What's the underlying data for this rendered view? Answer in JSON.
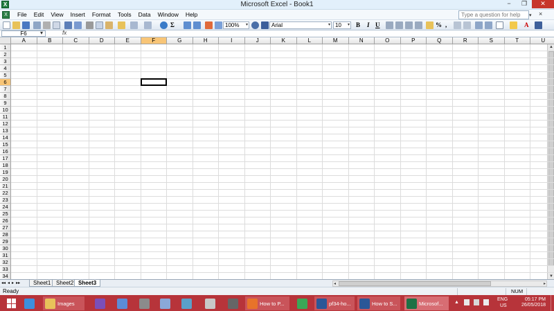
{
  "window": {
    "title": "Microsoft Excel - Book1",
    "app_icon": "X",
    "min": "−",
    "restore": "❐",
    "close": "✕"
  },
  "menu": {
    "items": [
      "File",
      "Edit",
      "View",
      "Insert",
      "Format",
      "Tools",
      "Data",
      "Window",
      "Help"
    ],
    "help_placeholder": "Type a question for help",
    "help_dropdown": "▾",
    "doc_close": "×"
  },
  "toolbar": {
    "zoom": "100%",
    "font": "Arial",
    "font_size": "10",
    "bold": "B",
    "italic": "I",
    "underline": "U",
    "autosum": "Σ",
    "percent": "%",
    "comma": ",",
    "accent_color": "#f2c94c",
    "dropdown": "▾"
  },
  "formula_bar": {
    "name_box": "F6",
    "fx": "fx",
    "name_dd": "▾",
    "content": ""
  },
  "grid": {
    "columns": [
      "A",
      "B",
      "C",
      "D",
      "E",
      "F",
      "G",
      "H",
      "I",
      "J",
      "K",
      "L",
      "M",
      "N",
      "O",
      "P",
      "Q",
      "R",
      "S",
      "T",
      "U"
    ],
    "rows": [
      "1",
      "2",
      "3",
      "4",
      "5",
      "6",
      "7",
      "8",
      "9",
      "10",
      "11",
      "12",
      "13",
      "14",
      "15",
      "16",
      "17",
      "18",
      "19",
      "20",
      "21",
      "22",
      "23",
      "24",
      "25",
      "26",
      "27",
      "28",
      "29",
      "30",
      "31",
      "32",
      "33",
      "34"
    ],
    "active_cell": "F6",
    "active_col": "F",
    "active_row": "6",
    "scroll_up": "▲",
    "scroll_down": "▼"
  },
  "sheets": {
    "nav": [
      "◂◂",
      "◂",
      "▸",
      "▸▸"
    ],
    "tabs": [
      "Sheet1",
      "Sheet2",
      "Sheet3"
    ],
    "active": "Sheet3",
    "scroll_left": "◂",
    "scroll_right": "▸"
  },
  "status": {
    "ready": "Ready",
    "num": "NUM"
  },
  "taskbar": {
    "apps": [
      {
        "name": "internet-explorer",
        "label": "",
        "color": "#3c8fdc"
      },
      {
        "name": "file-explorer",
        "label": "Images",
        "color": "#e8c25a"
      },
      {
        "name": "visual-studio",
        "label": "",
        "color": "#7b4fb8"
      },
      {
        "name": "app-2",
        "label": "",
        "color": "#5c8cd6"
      },
      {
        "name": "app-3",
        "label": "",
        "color": "#8b8b8b"
      },
      {
        "name": "app-4",
        "label": "",
        "color": "#8aa8d8"
      },
      {
        "name": "app-5",
        "label": "",
        "color": "#5aa0c8"
      },
      {
        "name": "app-6",
        "label": "",
        "color": "#c8c8c8"
      },
      {
        "name": "app-7",
        "label": "",
        "color": "#666666"
      },
      {
        "name": "firefox",
        "label": "How to P...",
        "color": "#e8732a"
      },
      {
        "name": "chrome",
        "label": "",
        "color": "#3aa757"
      },
      {
        "name": "word-1",
        "label": "pf34-ho...",
        "color": "#2b5797"
      },
      {
        "name": "word-2",
        "label": "How to S...",
        "color": "#2b5797"
      },
      {
        "name": "excel",
        "label": "Microsof...",
        "color": "#1e7145"
      }
    ],
    "tray": {
      "up": "▲",
      "lang": "ENG",
      "region": "US",
      "time": "05:17 PM",
      "date": "26/05/2018"
    }
  }
}
